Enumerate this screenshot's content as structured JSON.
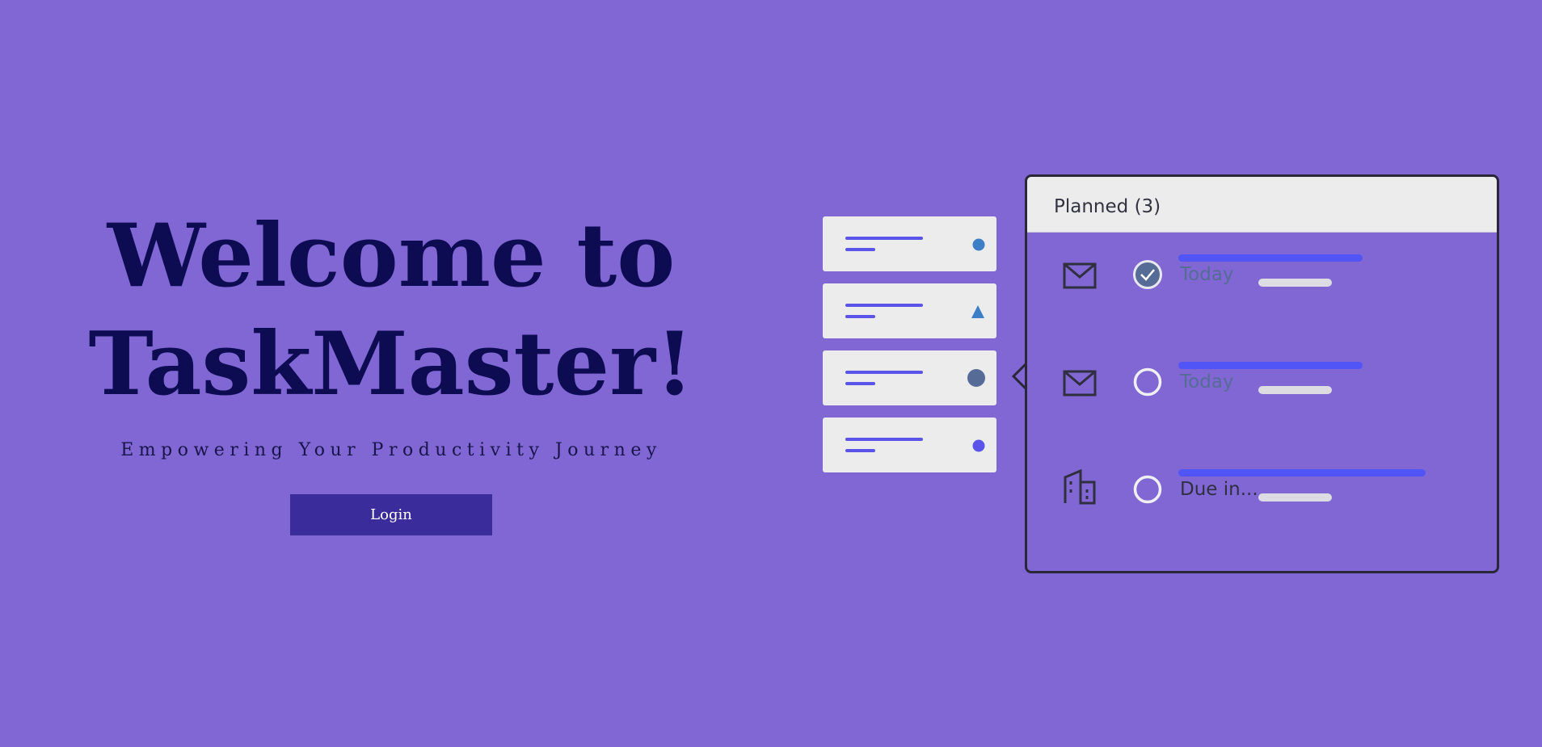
{
  "hero": {
    "title_line1": "Welcome to",
    "title_line2": "TaskMaster!",
    "subtitle": "Empowering Your Productivity Journey",
    "login_label": "Login"
  },
  "illustration": {
    "mini_cards": [
      {
        "marker": "dot-icon",
        "color": "#3d7ec6"
      },
      {
        "marker": "triangle-icon",
        "color": "#3d7ec6"
      },
      {
        "marker": "circle-icon",
        "color": "#566c96"
      },
      {
        "marker": "dot-icon",
        "color": "#5b54ea"
      }
    ],
    "panel": {
      "title": "Planned (3)",
      "tasks": [
        {
          "icon": "mail-icon",
          "checked": true,
          "due": "Today",
          "due_color": "#566c96"
        },
        {
          "icon": "mail-icon",
          "checked": false,
          "due": "Today",
          "due_color": "#566c96"
        },
        {
          "icon": "building-icon",
          "checked": false,
          "due": "Due in...",
          "due_color": "#2f2f40"
        }
      ]
    }
  },
  "colors": {
    "background": "#8067d4",
    "title": "#0d0c52",
    "login_button": "#3b2c9b",
    "accent_bar": "#5255f5",
    "card": "#ececec"
  }
}
